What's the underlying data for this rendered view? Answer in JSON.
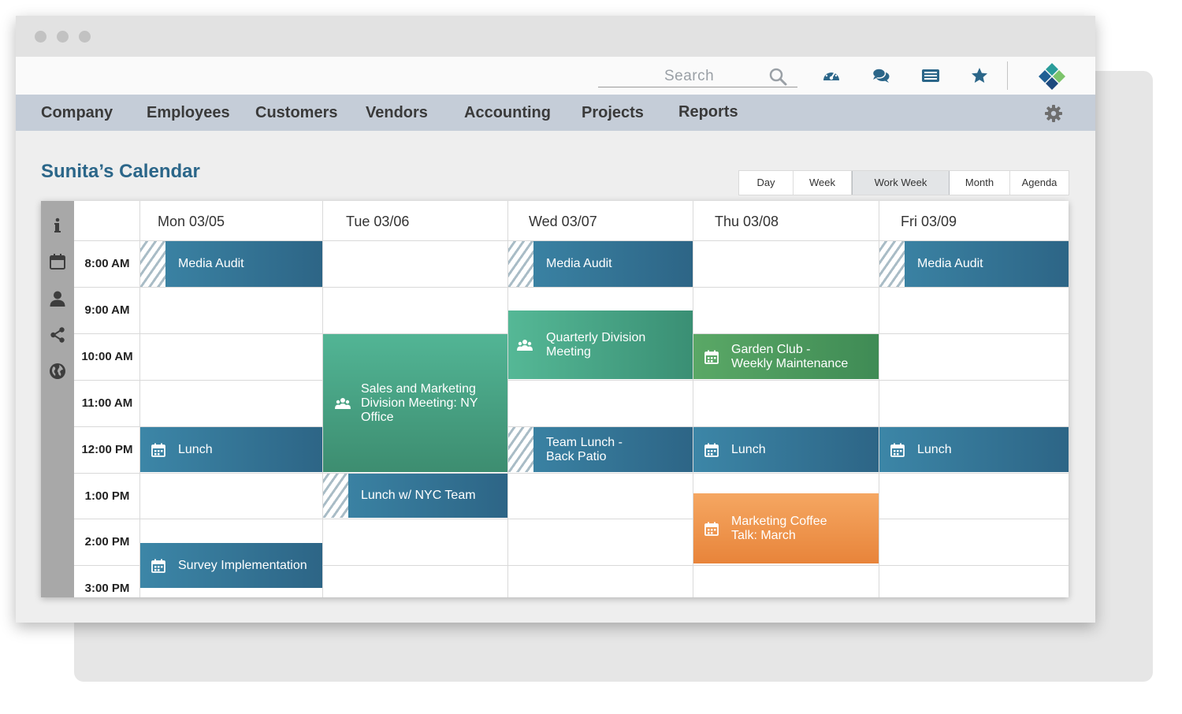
{
  "toolbar": {
    "search_placeholder": "Search",
    "icons": [
      "dashboard-icon",
      "chat-icon",
      "news-icon",
      "star-icon"
    ]
  },
  "nav": {
    "items": [
      "Company",
      "Employees",
      "Customers",
      "Vendors",
      "Accounting",
      "Projects",
      "Reports"
    ]
  },
  "page_title": "Sunita’s Calendar",
  "views": {
    "options": [
      "Day",
      "Week",
      "Work Week",
      "Month",
      "Agenda"
    ],
    "selected": "Work Week"
  },
  "calendar": {
    "days": [
      "Mon 03/05",
      "Tue 03/06",
      "Wed 03/07",
      "Thu 03/08",
      "Fri 03/09"
    ],
    "times": [
      "8:00 AM",
      "9:00 AM",
      "10:00 AM",
      "11:00 AM",
      "12:00 PM",
      "1:00 PM",
      "2:00 PM",
      "3:00 PM"
    ],
    "events": {
      "mon_media_audit": "Media Audit",
      "mon_lunch": "Lunch",
      "mon_survey": "Survey Implementation",
      "tue_sales_meeting": "Sales and Marketing Division Meeting: NY Office",
      "tue_lunch_nyc": "Lunch w/ NYC Team",
      "wed_media_audit": "Media Audit",
      "wed_quarterly": "Quarterly Division Meeting",
      "wed_team_lunch": "Team Lunch - Back Patio",
      "thu_garden_club": "Garden Club - Weekly Maintenance",
      "thu_lunch": "Lunch",
      "thu_coffee_talk": "Marketing Coffee Talk: March",
      "fri_media_audit": "Media Audit",
      "fri_lunch": "Lunch"
    }
  },
  "colors": {
    "brand_blue": "#2b6689",
    "event_blue": "#2d6586",
    "event_teal": "#3d8d70",
    "event_green": "#3f8b55",
    "event_orange": "#e8843a"
  }
}
